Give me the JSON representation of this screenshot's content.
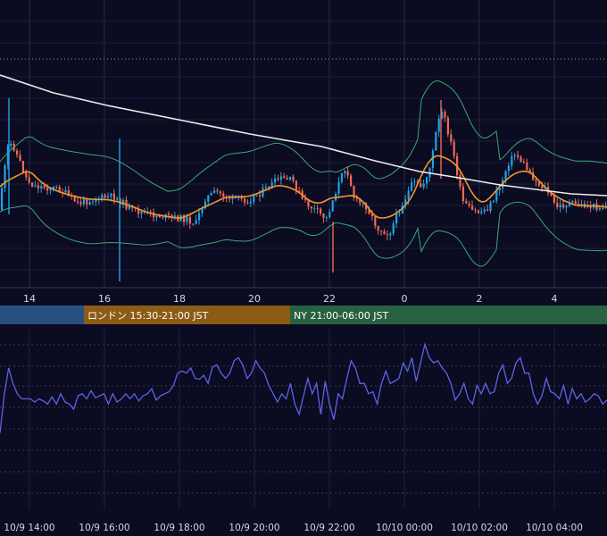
{
  "chart_data": [
    {
      "type": "candlestick",
      "x_ticks": [
        "14",
        "16",
        "18",
        "20",
        "22",
        "0",
        "2",
        "4"
      ],
      "up_color": "#1fa3e6",
      "down_color": "#ef6b54",
      "ma_fast_color": "#f2962c",
      "ma_slow_color": "#ececec",
      "bands_color": "#3aa873",
      "grid": true,
      "sessions": [
        {
          "label": "",
          "color": "#28507f"
        },
        {
          "label": "ロンドン 15:30-21:00 JST",
          "color": "#8c5b16"
        },
        {
          "label": "NY 21:00-06:00 JST",
          "color": "#276240"
        }
      ]
    },
    {
      "type": "line",
      "x_ticks": [
        "10/9 14:00",
        "10/9 16:00",
        "10/9 18:00",
        "10/9 20:00",
        "10/9 22:00",
        "10/10 00:00",
        "10/10 02:00",
        "10/10 04:00"
      ],
      "series_color": "#5c64e6",
      "grid": true,
      "values": [
        22,
        60,
        85,
        70,
        60,
        55,
        55,
        55,
        52,
        55,
        53,
        50,
        57,
        50,
        60,
        52,
        50,
        45,
        58,
        60,
        55,
        63,
        56,
        58,
        60,
        50,
        60,
        52,
        55,
        60,
        55,
        60,
        53,
        58,
        60,
        65,
        54,
        58,
        60,
        62,
        68,
        80,
        82,
        80,
        85,
        75,
        74,
        78,
        70,
        86,
        88,
        80,
        75,
        80,
        92,
        95,
        88,
        75,
        80,
        92,
        85,
        80,
        68,
        60,
        52,
        60,
        55,
        70,
        50,
        40,
        58,
        75,
        60,
        70,
        40,
        72,
        50,
        35,
        60,
        55,
        75,
        92,
        85,
        70,
        70,
        60,
        62,
        50,
        70,
        82,
        70,
        72,
        75,
        90,
        82,
        95,
        72,
        90,
        108,
        95,
        90,
        92,
        85,
        80,
        70,
        54,
        60,
        70,
        55,
        50,
        68,
        60,
        70,
        60,
        62,
        80,
        88,
        70,
        75,
        90,
        95,
        80,
        80,
        60,
        50,
        58,
        75,
        62,
        60,
        55,
        68,
        50,
        65,
        55,
        60,
        52,
        55,
        60,
        58,
        50,
        54
      ]
    }
  ]
}
